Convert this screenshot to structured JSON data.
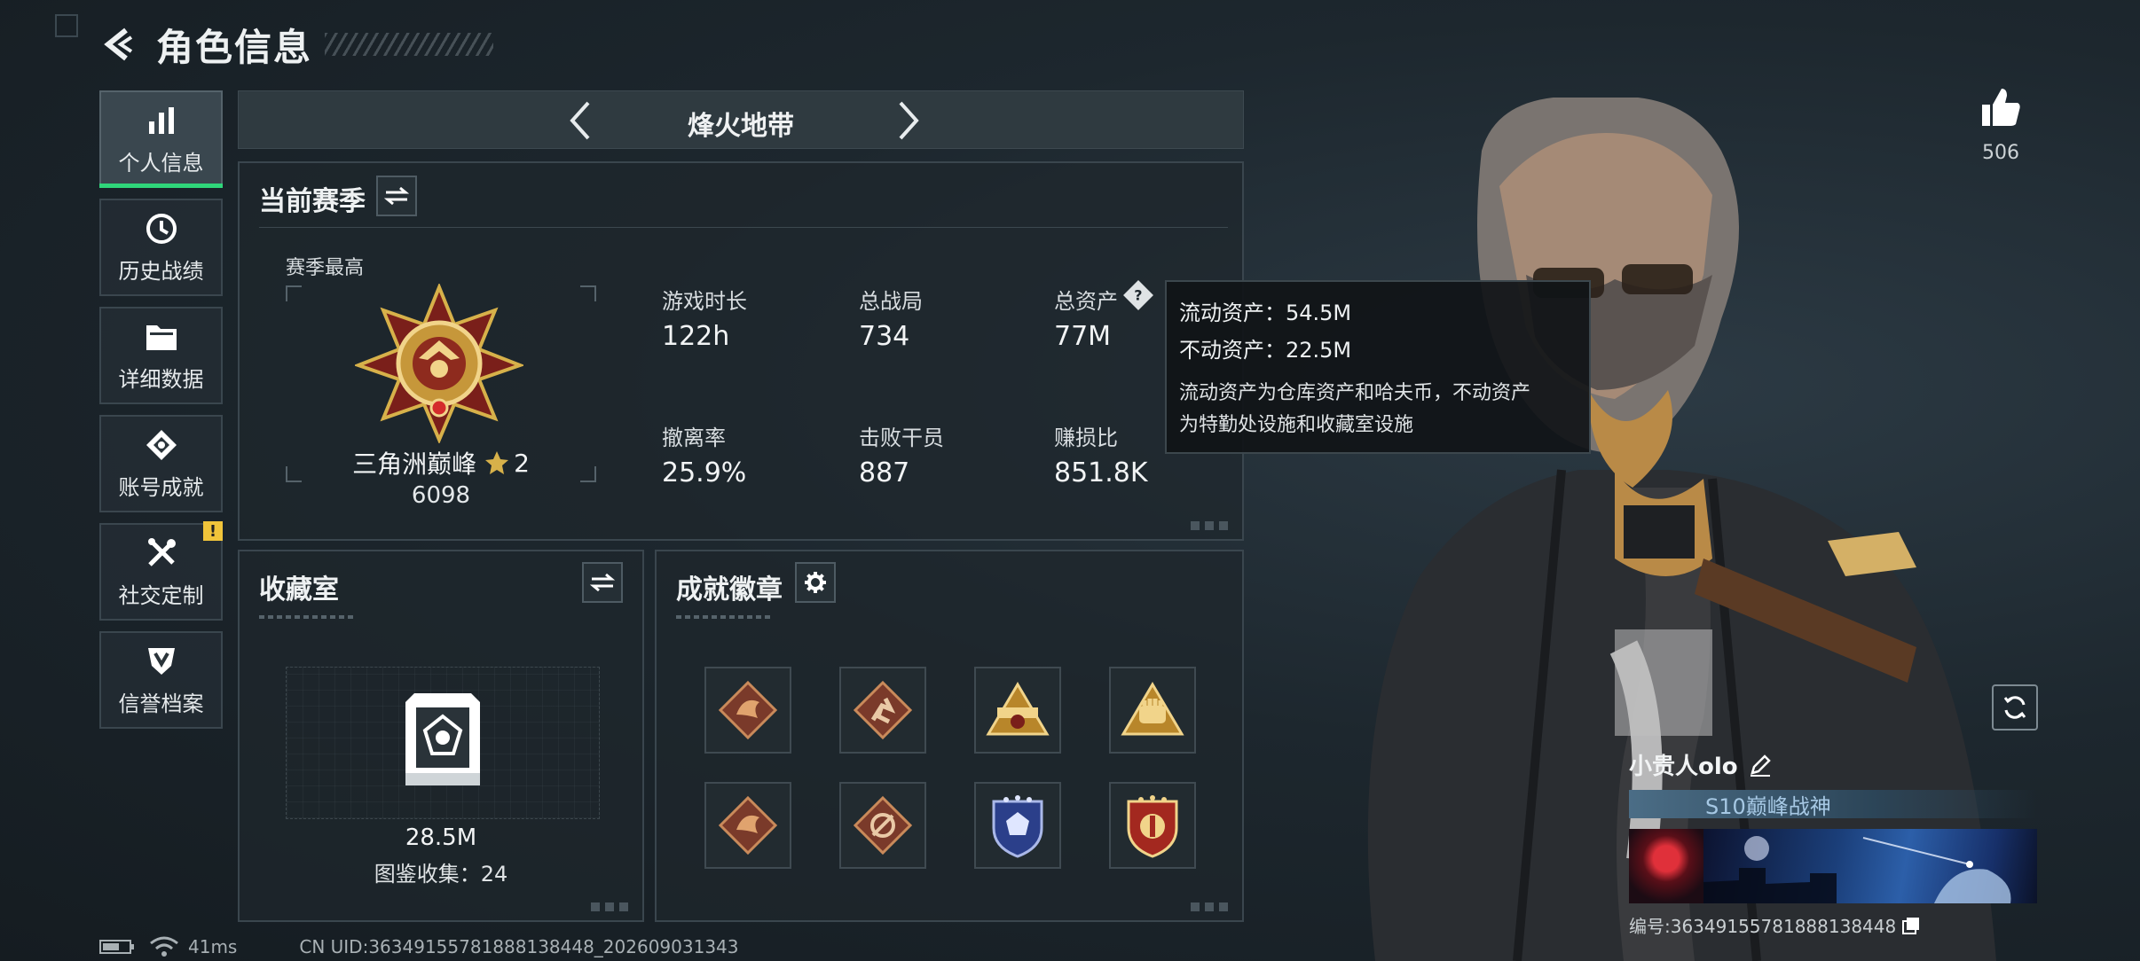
{
  "header": {
    "title": "角色信息"
  },
  "sidebar": {
    "items": [
      {
        "label": "个人信息",
        "icon": "bar-chart-icon",
        "active": true
      },
      {
        "label": "历史战绩",
        "icon": "history-icon"
      },
      {
        "label": "详细数据",
        "icon": "folder-icon"
      },
      {
        "label": "账号成就",
        "icon": "achievement-icon"
      },
      {
        "label": "社交定制",
        "icon": "tools-icon",
        "badge": "!"
      },
      {
        "label": "信誉档案",
        "icon": "reputation-icon"
      }
    ]
  },
  "mode": {
    "title": "烽火地带"
  },
  "season": {
    "title": "当前赛季",
    "best_label": "赛季最高",
    "rank_name": "三角洲巅峰",
    "rank_stars": "2",
    "rank_score": "6098",
    "stats": [
      {
        "label": "游戏时长",
        "value": "122h"
      },
      {
        "label": "总战局",
        "value": "734"
      },
      {
        "label": "总资产",
        "value": "77M"
      },
      {
        "label": "撤离率",
        "value": "25.9%"
      },
      {
        "label": "击败干员",
        "value": "887"
      },
      {
        "label": "赚损比",
        "value": "851.8K"
      }
    ]
  },
  "tooltip": {
    "liquid": "流动资产：54.5M",
    "fixed": "不动资产：22.5M",
    "desc1": "流动资产为仓库资产和哈夫币，不动资产",
    "desc2": "为特勤处设施和收藏室设施"
  },
  "collection": {
    "title": "收藏室",
    "value": "28.5M",
    "catalog": "图鉴收集：24"
  },
  "badges": {
    "title": "成就徽章"
  },
  "likes": {
    "count": "506"
  },
  "profile": {
    "name": "小贵人olo",
    "title": "S10巅峰战神",
    "uid": "编号:36349155781888138448"
  },
  "status": {
    "ping": "41ms",
    "cn_uid": "CN UID:36349155781888138448_202609031343"
  },
  "colors": {
    "accent_green": "#2fd67a",
    "warning_yellow": "#f0c43a",
    "rank_gold": "#d7b14a"
  }
}
